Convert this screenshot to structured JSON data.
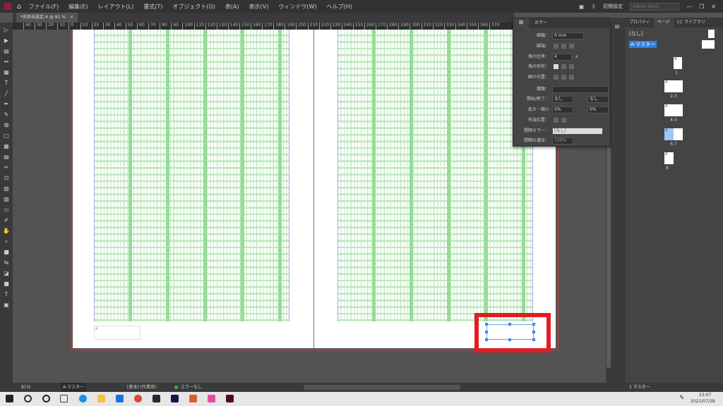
{
  "menubar": {
    "items": [
      "ファイル(F)",
      "編集(E)",
      "レイアウト(L)",
      "書式(T)",
      "オブジェクト(O)",
      "表(A)",
      "表示(V)",
      "ウィンドウ(W)",
      "ヘルプ(H)"
    ],
    "workspace": "初期設定",
    "stock_placeholder": "Adobe Stock"
  },
  "document": {
    "tab_title": "*名称未設定-4 @ 81 %"
  },
  "ruler": {
    "ticks": [
      "40",
      "30",
      "20",
      "10",
      "0",
      "10",
      "20",
      "30",
      "40",
      "50",
      "60",
      "70",
      "80",
      "90",
      "100",
      "110",
      "120",
      "130",
      "140",
      "150",
      "160",
      "170",
      "180",
      "190",
      "200",
      "210",
      "220",
      "230",
      "240",
      "250",
      "260",
      "270",
      "280",
      "290",
      "300",
      "310",
      "320",
      "330",
      "340",
      "350",
      "360",
      "370"
    ]
  },
  "canvas": {
    "frame_label": "A",
    "accent_color": "#e31c23"
  },
  "stroke_panel": {
    "tabs": [
      "線",
      "カラー"
    ],
    "weight_label": "線幅：",
    "weight_value": "0 mm",
    "cap_label": "線端：",
    "miter_label": "角の比率：",
    "miter_value": "4",
    "miter_unit": "x",
    "join_label": "角の形状：",
    "align_label": "線の位置：",
    "type_label": "種類：",
    "start_end_label": "開始/終了：",
    "start_value": "なし",
    "end_value": "なし",
    "scale_label": "拡大・縮小",
    "scale_start": "0%",
    "scale_end": "0%",
    "align_tip_label": "先端位置：",
    "gap_color_label": "間隔カラー：",
    "gap_color_value": "[なし]",
    "gap_tint_label": "間隔の濃淡：",
    "gap_tint_value": "100%"
  },
  "pages_panel": {
    "tabs": [
      "プロパティ",
      "ページ",
      "CC ライブラリ"
    ],
    "none_master": "[なし]",
    "a_master": "A-マスター",
    "pages": [
      "1",
      "2-3",
      "4-5",
      "6-7",
      "8"
    ],
    "page_prefix": "A",
    "footer": "1 マスター"
  },
  "statusbar": {
    "zoom": "81%",
    "page": "A-マスター",
    "preflight_profile": "[基本] (作業用)",
    "errors": "エラーなし",
    "error_color": "#3cb34a"
  },
  "taskbar": {
    "time": "23:07",
    "date": "2021/07/28"
  }
}
